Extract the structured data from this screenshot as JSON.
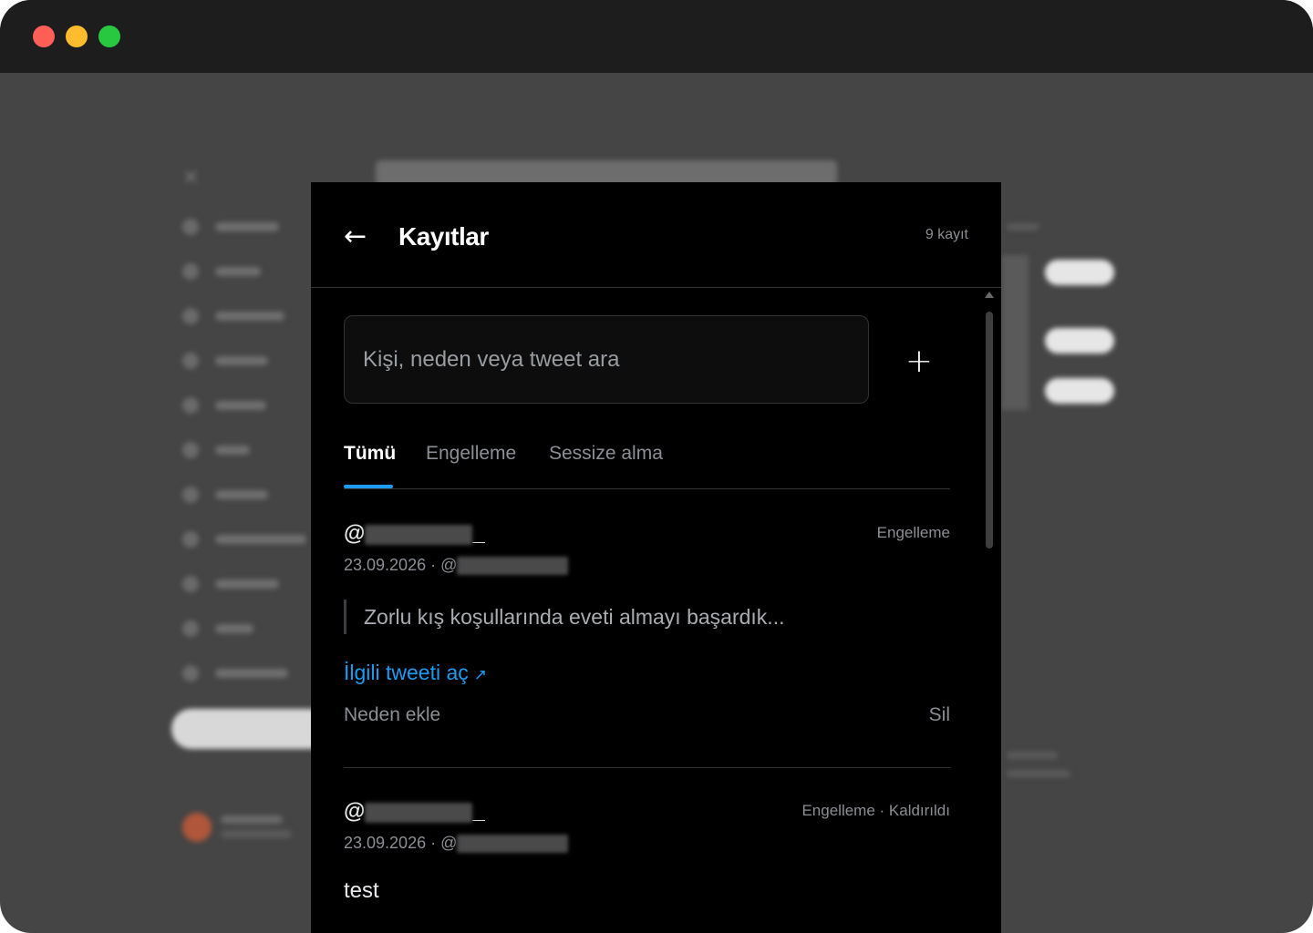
{
  "panel": {
    "title": "Kayıtlar",
    "count": "9 kayıt",
    "back_icon": "arrow-left-icon"
  },
  "search": {
    "placeholder": "Kişi, neden veya tweet ara",
    "value": ""
  },
  "add_button": {
    "label": "+",
    "icon": "plus-icon"
  },
  "tabs": [
    {
      "label": "Tümü",
      "active": true
    },
    {
      "label": "Engelleme",
      "active": false
    },
    {
      "label": "Sessize alma",
      "active": false
    }
  ],
  "records": [
    {
      "handle_prefix": "@",
      "handle_suffix": "_",
      "date": "23.09.2026 · @",
      "kind": "Engelleme",
      "quote": "Zorlu kış koşullarında eveti almayı başardık...",
      "open_link": "İlgili tweeti aç",
      "open_link_icon": "↗",
      "reason_label": "Neden ekle",
      "delete_label": "Sil"
    },
    {
      "handle_prefix": "@",
      "handle_suffix": "_",
      "date": "23.09.2026 · @",
      "kind": "Engelleme · Kaldırıldı",
      "note": "test"
    }
  ],
  "colors": {
    "accent": "#1d9bf0",
    "panel_bg": "#000000",
    "muted_text": "#8b8f94",
    "divider": "#2f3336"
  }
}
